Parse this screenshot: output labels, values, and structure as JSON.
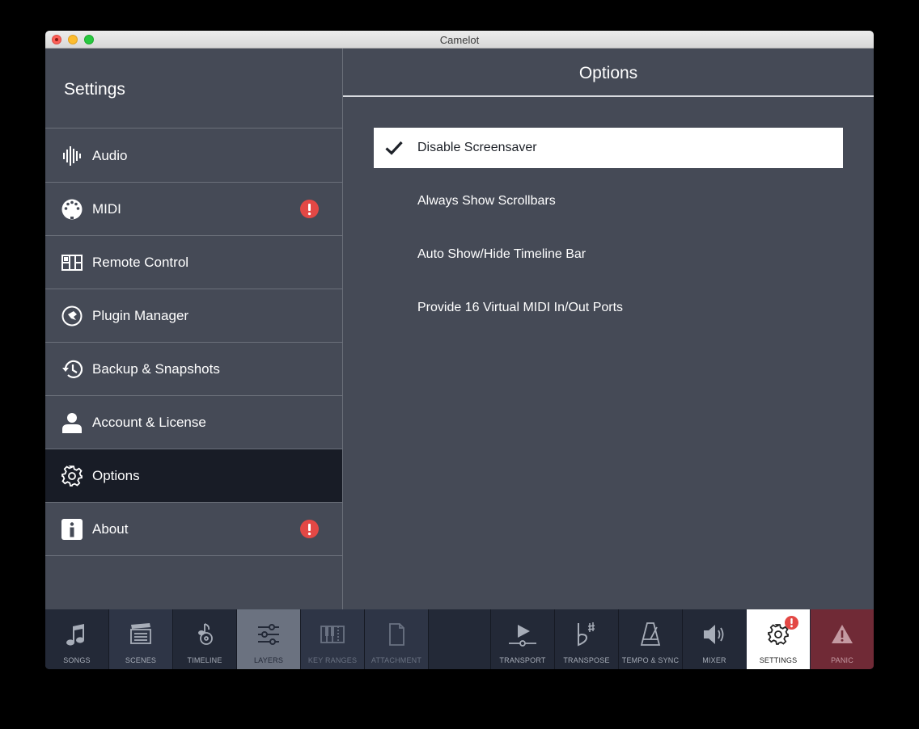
{
  "window": {
    "title": "Camelot"
  },
  "sidebar": {
    "title": "Settings",
    "items": [
      {
        "label": "Audio",
        "icon": "audio-waveform-icon",
        "alert": false,
        "active": false
      },
      {
        "label": "MIDI",
        "icon": "midi-connector-icon",
        "alert": true,
        "active": false
      },
      {
        "label": "Remote Control",
        "icon": "remote-control-icon",
        "alert": false,
        "active": false
      },
      {
        "label": "Plugin Manager",
        "icon": "plugin-icon",
        "alert": false,
        "active": false
      },
      {
        "label": "Backup & Snapshots",
        "icon": "history-icon",
        "alert": false,
        "active": false
      },
      {
        "label": "Account & License",
        "icon": "user-icon",
        "alert": false,
        "active": false
      },
      {
        "label": "Options",
        "icon": "gear-icon",
        "alert": false,
        "active": true
      },
      {
        "label": "About",
        "icon": "info-icon",
        "alert": true,
        "active": false
      }
    ]
  },
  "main": {
    "title": "Options",
    "options": [
      {
        "label": "Disable Screensaver",
        "checked": true
      },
      {
        "label": "Always Show Scrollbars",
        "checked": false
      },
      {
        "label": "Auto Show/Hide Timeline Bar",
        "checked": false
      },
      {
        "label": "Provide 16 Virtual MIDI In/Out Ports",
        "checked": false
      }
    ]
  },
  "toolbar": {
    "left": [
      {
        "label": "SONGS",
        "icon": "music-note-icon"
      },
      {
        "label": "SCENES",
        "icon": "clapperboard-icon"
      },
      {
        "label": "TIMELINE",
        "icon": "timeline-icon"
      },
      {
        "label": "LAYERS",
        "icon": "sliders-icon"
      },
      {
        "label": "KEY RANGES",
        "icon": "keyboard-icon"
      },
      {
        "label": "ATTACHMENT",
        "icon": "document-icon"
      }
    ],
    "right": [
      {
        "label": "TRANSPORT",
        "icon": "play-icon"
      },
      {
        "label": "TRANSPOSE",
        "icon": "flat-sharp-icon"
      },
      {
        "label": "TEMPO & SYNC",
        "icon": "metronome-icon"
      },
      {
        "label": "MIXER",
        "icon": "speaker-icon"
      },
      {
        "label": "SETTINGS",
        "icon": "gear-icon",
        "badge": true
      },
      {
        "label": "PANIC",
        "icon": "warning-triangle-icon"
      }
    ]
  },
  "colors": {
    "panel": "#454a56",
    "active_row": "#181c26",
    "toolbar": "#232937",
    "alert": "#e34845",
    "panic": "#702a36"
  }
}
